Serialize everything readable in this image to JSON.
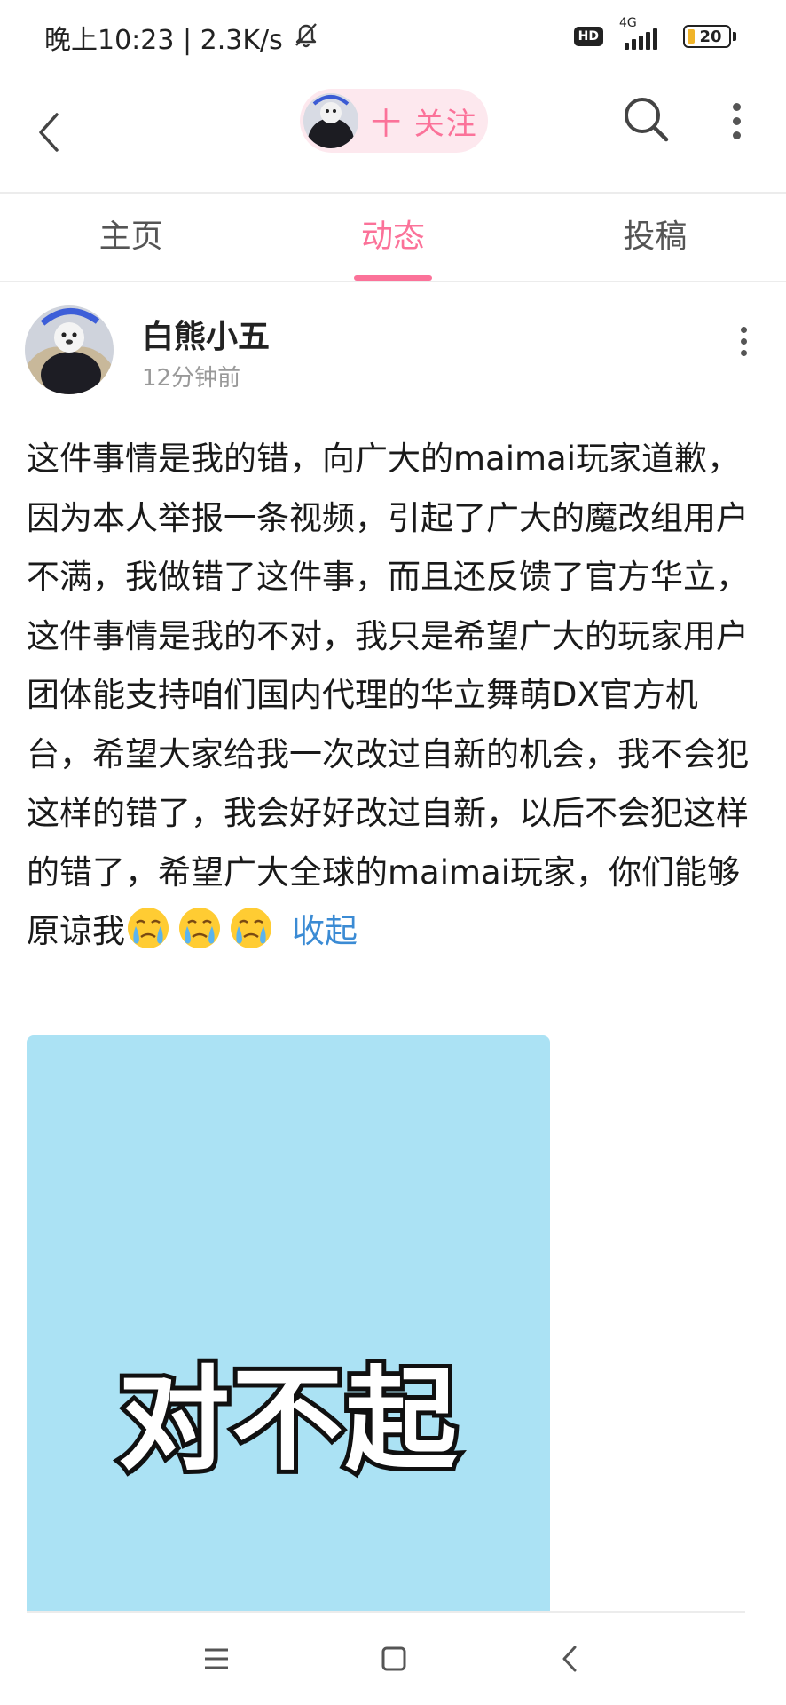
{
  "status_bar": {
    "time_text": "晚上10:23 | 2.3K/s",
    "hd_label": "HD",
    "network_label": "4G",
    "battery_level": "20",
    "icons": [
      "mute-bell-icon",
      "hd-icon",
      "signal-icon",
      "battery-icon"
    ]
  },
  "top_nav": {
    "follow_label": "十 关注",
    "icons": [
      "back-arrow-icon",
      "search-icon",
      "more-vertical-icon"
    ],
    "accent_color": "#fb7299"
  },
  "tabs": [
    {
      "label": "主页",
      "active": false
    },
    {
      "label": "动态",
      "active": true
    },
    {
      "label": "投稿",
      "active": false
    }
  ],
  "post": {
    "author": "白熊小五",
    "time": "12分钟前",
    "text": "这件事情是我的错，向广大的maimai玩家道歉，因为本人举报一条视频，引起了广大的魔改组用户不满，我做错了这件事，而且还反馈了官方华立，这件事情是我的不对，我只是希望广大的玩家用户团体能支持咱们国内代理的华立舞萌DX官方机台，希望大家给我一次改过自新的机会，我不会犯这样的错了，我会好好改过自新，以后不会犯这样的错了，希望广大全球的maimai玩家，你们能够原谅我",
    "emoji_name": "crying-face-emoji",
    "emoji_count": 3,
    "collapse_label": "收起",
    "image": {
      "caption": "对不起",
      "background_color": "#abe2f4"
    }
  },
  "system_nav": {
    "icons": [
      "menu-icon",
      "home-square-icon",
      "back-chevron-icon"
    ]
  }
}
